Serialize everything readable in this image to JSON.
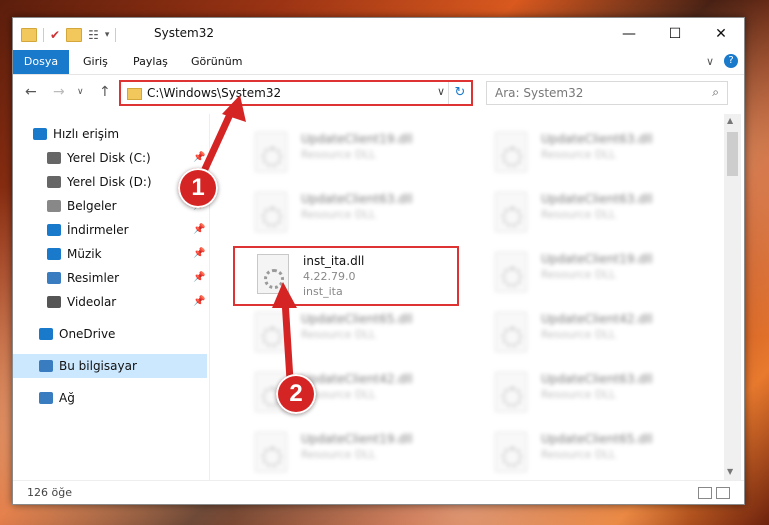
{
  "window": {
    "title": "System32",
    "controls": {
      "minimize": "—",
      "maximize": "☐",
      "close": "✕"
    }
  },
  "ribbon": {
    "tabs": [
      "Dosya",
      "Giriş",
      "Paylaş",
      "Görünüm"
    ],
    "expand": "∨",
    "help": "?"
  },
  "nav": {
    "back": "←",
    "forward": "→",
    "recent": "∨",
    "up": "↑",
    "address": "C:\\Windows\\System32",
    "address_dropdown": "∨",
    "refresh": "↻",
    "search_placeholder": "Ara: System32"
  },
  "sidebar": {
    "items": [
      {
        "label": "Hızlı erişim",
        "icon": "star-icon",
        "pinned": false
      },
      {
        "label": "Yerel Disk (C:)",
        "icon": "drive-icon",
        "pinned": true
      },
      {
        "label": "Yerel Disk (D:)",
        "icon": "drive-icon",
        "pinned": true
      },
      {
        "label": "Belgeler",
        "icon": "documents-icon",
        "pinned": true
      },
      {
        "label": "İndirmeler",
        "icon": "download-icon",
        "pinned": true
      },
      {
        "label": "Müzik",
        "icon": "music-icon",
        "pinned": true
      },
      {
        "label": "Resimler",
        "icon": "pictures-icon",
        "pinned": true
      },
      {
        "label": "Videolar",
        "icon": "videos-icon",
        "pinned": true
      },
      {
        "label": "OneDrive",
        "icon": "cloud-icon",
        "pinned": false
      },
      {
        "label": "Bu bilgisayar",
        "icon": "computer-icon",
        "pinned": false
      },
      {
        "label": "Ağ",
        "icon": "network-icon",
        "pinned": false
      }
    ],
    "pin_glyph": "📌"
  },
  "files": [
    {
      "name": "UpdateClient19.dll",
      "desc": "Resource DLL",
      "extra": ""
    },
    {
      "name": "UpdateClient63.dll",
      "desc": "Resource DLL",
      "extra": ""
    },
    {
      "name": "UpdateClient63.dll",
      "desc": "Resource DLL",
      "extra": ""
    },
    {
      "name": "UpdateClient63.dll",
      "desc": "Resource DLL",
      "extra": ""
    },
    {
      "name": "inst_ita.dll",
      "desc": "4.22.79.0",
      "extra": "inst_ita"
    },
    {
      "name": "UpdateClient19.dll",
      "desc": "Resource DLL",
      "extra": ""
    },
    {
      "name": "UpdateClient65.dll",
      "desc": "Resource DLL",
      "extra": ""
    },
    {
      "name": "UpdateClient42.dll",
      "desc": "Resource DLL",
      "extra": ""
    },
    {
      "name": "UpdateClient42.dll",
      "desc": "Resource DLL",
      "extra": ""
    },
    {
      "name": "UpdateClient63.dll",
      "desc": "Resource DLL",
      "extra": ""
    },
    {
      "name": "UpdateClient19.dll",
      "desc": "Resource DLL",
      "extra": ""
    },
    {
      "name": "UpdateClient65.dll",
      "desc": "Resource DLL",
      "extra": ""
    }
  ],
  "status": {
    "count": "126 öğe"
  },
  "callouts": [
    "1",
    "2"
  ],
  "colors": {
    "accent": "#1979ca",
    "highlight": "#d33333",
    "callout": "#d52424"
  }
}
